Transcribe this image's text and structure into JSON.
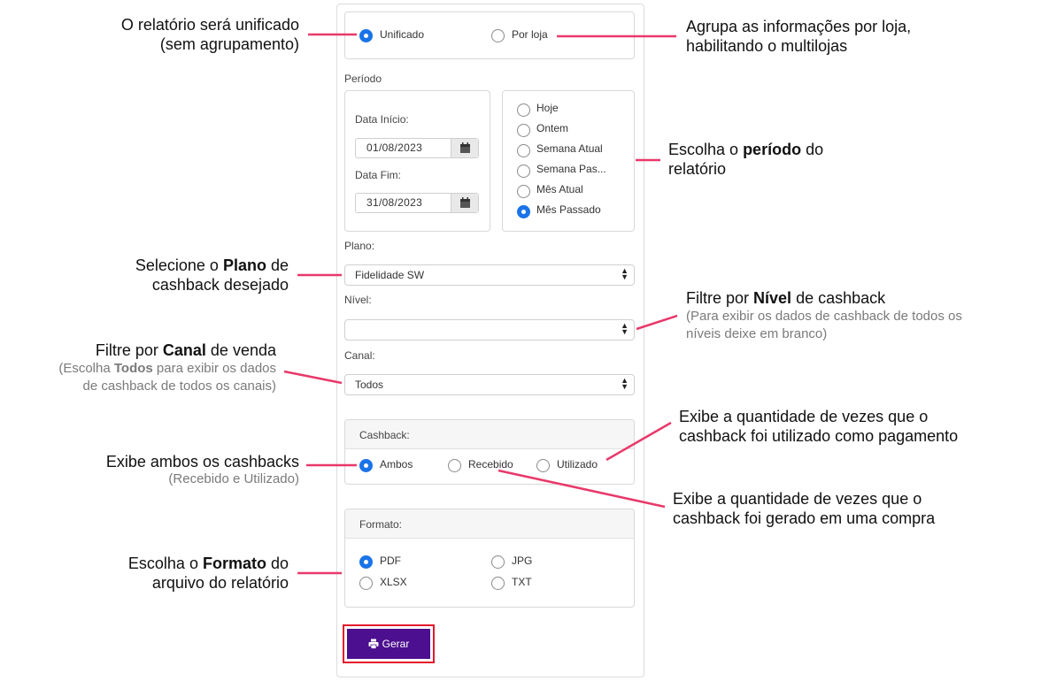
{
  "form": {
    "grouping": {
      "options": [
        {
          "label": "Unificado",
          "selected": true
        },
        {
          "label": "Por loja",
          "selected": false
        }
      ]
    },
    "periodo": {
      "title": "Período",
      "data_inicio_label": "Data Início:",
      "data_inicio_value": "01/08/2023",
      "data_fim_label": "Data Fim:",
      "data_fim_value": "31/08/2023",
      "quick_options": [
        {
          "label": "Hoje",
          "selected": false
        },
        {
          "label": "Ontem",
          "selected": false
        },
        {
          "label": "Semana Atual",
          "selected": false
        },
        {
          "label": "Semana Pas...",
          "selected": false
        },
        {
          "label": "Mês Atual",
          "selected": false
        },
        {
          "label": "Mês Passado",
          "selected": true
        }
      ]
    },
    "plano": {
      "label": "Plano:",
      "value": "Fidelidade SW"
    },
    "nivel": {
      "label": "Nível:",
      "value": ""
    },
    "canal": {
      "label": "Canal:",
      "value": "Todos"
    },
    "cashback": {
      "title": "Cashback:",
      "options": [
        {
          "label": "Ambos",
          "selected": true
        },
        {
          "label": "Recebido",
          "selected": false
        },
        {
          "label": "Utilizado",
          "selected": false
        }
      ]
    },
    "formato": {
      "title": "Formato:",
      "options": [
        {
          "label": "PDF",
          "selected": true
        },
        {
          "label": "JPG",
          "selected": false
        },
        {
          "label": "XLSX",
          "selected": false
        },
        {
          "label": "TXT",
          "selected": false
        }
      ]
    },
    "gerar_label": "Gerar"
  },
  "annotations": {
    "unificado": [
      "O relatório será unificado",
      "(sem agrupamento)"
    ],
    "por_loja": [
      "Agrupa as informações por loja,",
      "habilitando o multilojas"
    ],
    "periodo_pre": "Escolha o ",
    "periodo_bold": "período",
    "periodo_post": " do",
    "periodo_line2": "relatório",
    "plano_pre": "Selecione o ",
    "plano_bold": "Plano",
    "plano_post": " de",
    "plano_line2": "cashback desejado",
    "nivel_pre": "Filtre por ",
    "nivel_bold": "Nível",
    "nivel_post": " de cashback",
    "nivel_sub": [
      "(Para exibir os dados de cashback de todos os",
      "níveis deixe em branco)"
    ],
    "canal_pre": "Filtre por ",
    "canal_bold": "Canal",
    "canal_post": " de venda",
    "canal_sub1_pre": "(Escolha ",
    "canal_sub1_bold": "Todos",
    "canal_sub1_post": " para exibir os dados",
    "canal_sub2": "de cashback de todos os canais)",
    "ambos": [
      "Exibe ambos os cashbacks",
      "(Recebido e Utilizado)"
    ],
    "utilizado": [
      "Exibe a quantidade de vezes que o",
      "cashback foi utilizado como pagamento"
    ],
    "recebido": [
      "Exibe a quantidade de vezes que o",
      "cashback foi gerado em uma compra"
    ],
    "formato_pre": "Escolha o ",
    "formato_bold": "Formato",
    "formato_post": " do",
    "formato_line2": "arquivo do relatório"
  },
  "colors": {
    "accent": "#1a73e8",
    "annotation_line": "#e8396a",
    "button": "#4b0f8f",
    "button_outline": "#e3182d"
  }
}
